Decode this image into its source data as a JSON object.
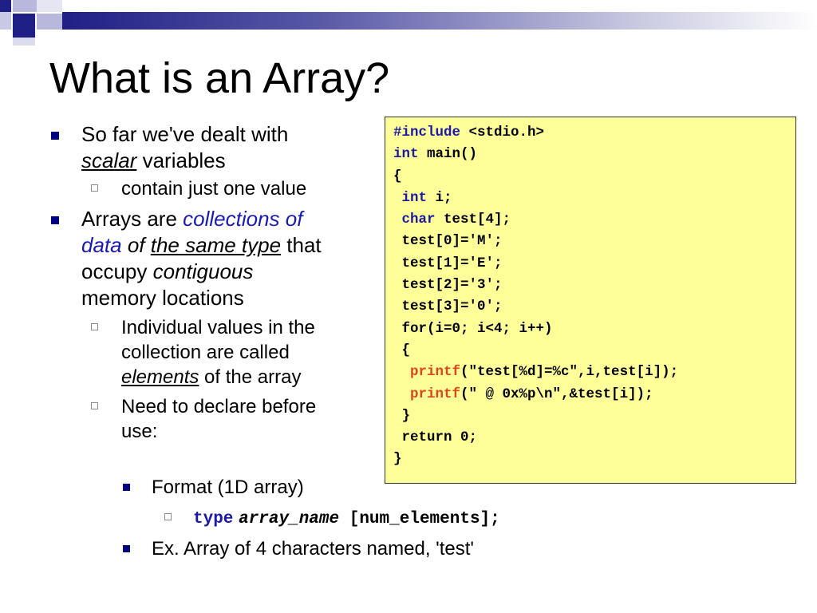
{
  "slide": {
    "title": "What is an Array?",
    "colors": {
      "accent": "#1f1f86",
      "keyword": "#1a1aa6",
      "function": "#e0451a",
      "code_bg": "#ffff99"
    }
  },
  "bullets": {
    "b1": {
      "l1": "So far we've dealt with",
      "scalar": "scalar",
      "variables": " variables"
    },
    "b1_sub": "contain just one value",
    "b2": {
      "l1a": "Arrays are ",
      "l1b": "collections of",
      "l2a": "data",
      "l2b": " of ",
      "l2c": "the same type",
      "l2d": " that",
      "l3a": "occupy ",
      "l3b": "contiguous",
      "l4": "memory locations"
    },
    "b2_sub1": {
      "l1": "Individual values in the",
      "l2": "collection are called",
      "l3a": "elements",
      "l3b": " of the array"
    },
    "b2_sub2": {
      "l1": "Need to declare before",
      "l2": "use:"
    },
    "format": "Format (1D array)",
    "syntax": {
      "type": "type",
      "name": "array_name",
      "rest": " [num_elements];"
    },
    "example": "Ex. Array of 4 characters named, 'test'"
  },
  "code": [
    {
      "kw": "#include",
      "rest": " <stdio.h>"
    },
    {
      "kw": "int",
      "rest": " main()"
    },
    {
      "plain": "{"
    },
    {
      "indent": " ",
      "kw": "int",
      "rest": " i;"
    },
    {
      "indent": " ",
      "kw": "char",
      "rest": " test[4];"
    },
    {
      "plain": " test[0]='M';"
    },
    {
      "plain": " test[1]='E';"
    },
    {
      "plain": " test[2]='3';"
    },
    {
      "plain": " test[3]='0';"
    },
    {
      "plain": " for(i=0; i<4; i++)"
    },
    {
      "plain": " {"
    },
    {
      "indent": "  ",
      "fn": "printf",
      "rest": "(\"test[%d]=%c\",i,test[i]);"
    },
    {
      "indent": "  ",
      "fn": "printf",
      "rest": "(\" @ 0x%p\\n\",&test[i]);"
    },
    {
      "plain": " }"
    },
    {
      "plain": " return 0;"
    },
    {
      "plain": "}"
    }
  ]
}
